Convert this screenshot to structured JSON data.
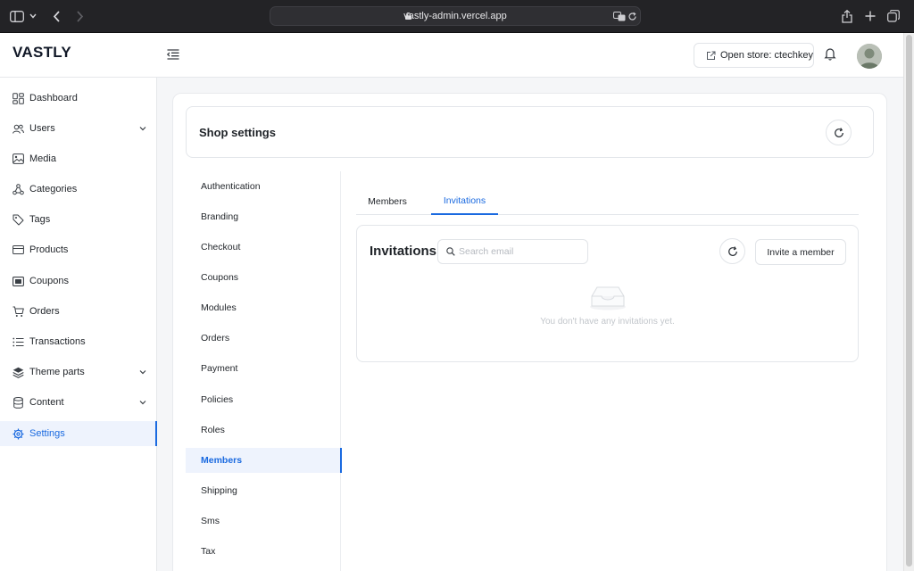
{
  "browser": {
    "url": "vastly-admin.vercel.app"
  },
  "header": {
    "logo": "VASTLY",
    "open_store_label": "Open store: ctechkey"
  },
  "sidebar": {
    "items": [
      {
        "label": "Dashboard",
        "icon": "dashboard-icon",
        "expandable": false
      },
      {
        "label": "Users",
        "icon": "users-icon",
        "expandable": true
      },
      {
        "label": "Media",
        "icon": "image-icon",
        "expandable": false
      },
      {
        "label": "Categories",
        "icon": "categories-icon",
        "expandable": false
      },
      {
        "label": "Tags",
        "icon": "tag-icon",
        "expandable": false
      },
      {
        "label": "Products",
        "icon": "products-icon",
        "expandable": false
      },
      {
        "label": "Coupons",
        "icon": "coupon-icon",
        "expandable": false
      },
      {
        "label": "Orders",
        "icon": "cart-icon",
        "expandable": false
      },
      {
        "label": "Transactions",
        "icon": "list-icon",
        "expandable": false
      },
      {
        "label": "Theme parts",
        "icon": "layers-icon",
        "expandable": true
      },
      {
        "label": "Content",
        "icon": "database-icon",
        "expandable": true
      },
      {
        "label": "Settings",
        "icon": "gear-icon",
        "expandable": false,
        "active": true
      }
    ]
  },
  "shop_settings": {
    "title": "Shop settings",
    "nav": [
      "Authentication",
      "Branding",
      "Checkout",
      "Coupons",
      "Modules",
      "Orders",
      "Payment",
      "Policies",
      "Roles",
      "Members",
      "Shipping",
      "Sms",
      "Tax"
    ],
    "active_nav": "Members"
  },
  "tabs": {
    "members": "Members",
    "invitations": "Invitations",
    "active": "Invitations"
  },
  "invitations": {
    "title": "Invitations",
    "search_placeholder": "Search email",
    "invite_label": "Invite a member",
    "empty_text": "You don't have any invitations yet."
  },
  "colors": {
    "accent": "#1a6ae0",
    "active_bg": "#eef3fd"
  }
}
